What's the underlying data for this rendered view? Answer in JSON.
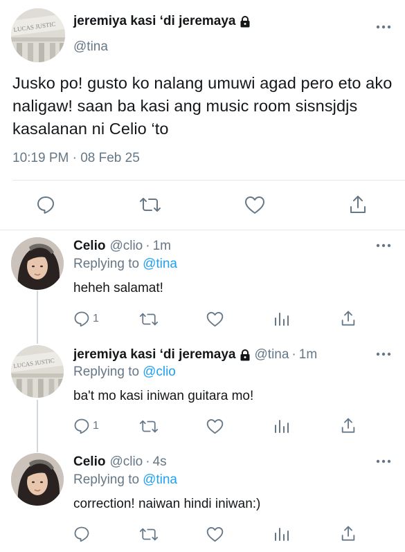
{
  "main_tweet": {
    "display_name": "jeremiya kasi ‘di jeremaya",
    "handle": "@tina",
    "text": "Jusko po! gusto ko nalang umuwi agad pero eto ako naligaw! saan ba kasi ang music room sisnsjdjs kasalanan ni Celio ‘to",
    "timestamp": "10:19 PM · 08 Feb 25",
    "avatar_icon": "building-avatar",
    "avatar_inscription": "LUCAS JUSTIC"
  },
  "replies": [
    {
      "display_name": "Celio",
      "handle": "@clio",
      "separator": "·",
      "time": "1m",
      "replying_label": "Replying to",
      "replying_to": "@tina",
      "text": "heheh salamat!",
      "reply_count": "1",
      "avatar_icon": "girl-avatar"
    },
    {
      "display_name": "jeremiya kasi ‘di jeremaya",
      "handle": "@tina",
      "separator": "·",
      "time": "1m",
      "replying_label": "Replying to",
      "replying_to": "@clio",
      "text": "ba't mo kasi iniwan guitara mo!",
      "reply_count": "1",
      "avatar_icon": "building-avatar",
      "avatar_inscription": "LUCAS JUSTIC"
    },
    {
      "display_name": "Celio",
      "handle": "@clio",
      "separator": "·",
      "time": "4s",
      "replying_label": "Replying to",
      "replying_to": "@tina",
      "text": "correction! naiwan hindi iniwan:)",
      "reply_count": "",
      "avatar_icon": "girl-avatar"
    }
  ],
  "colors": {
    "text": "#14171a",
    "secondary": "#657786",
    "link": "#1da1f2",
    "divider": "#e1e8ed"
  }
}
